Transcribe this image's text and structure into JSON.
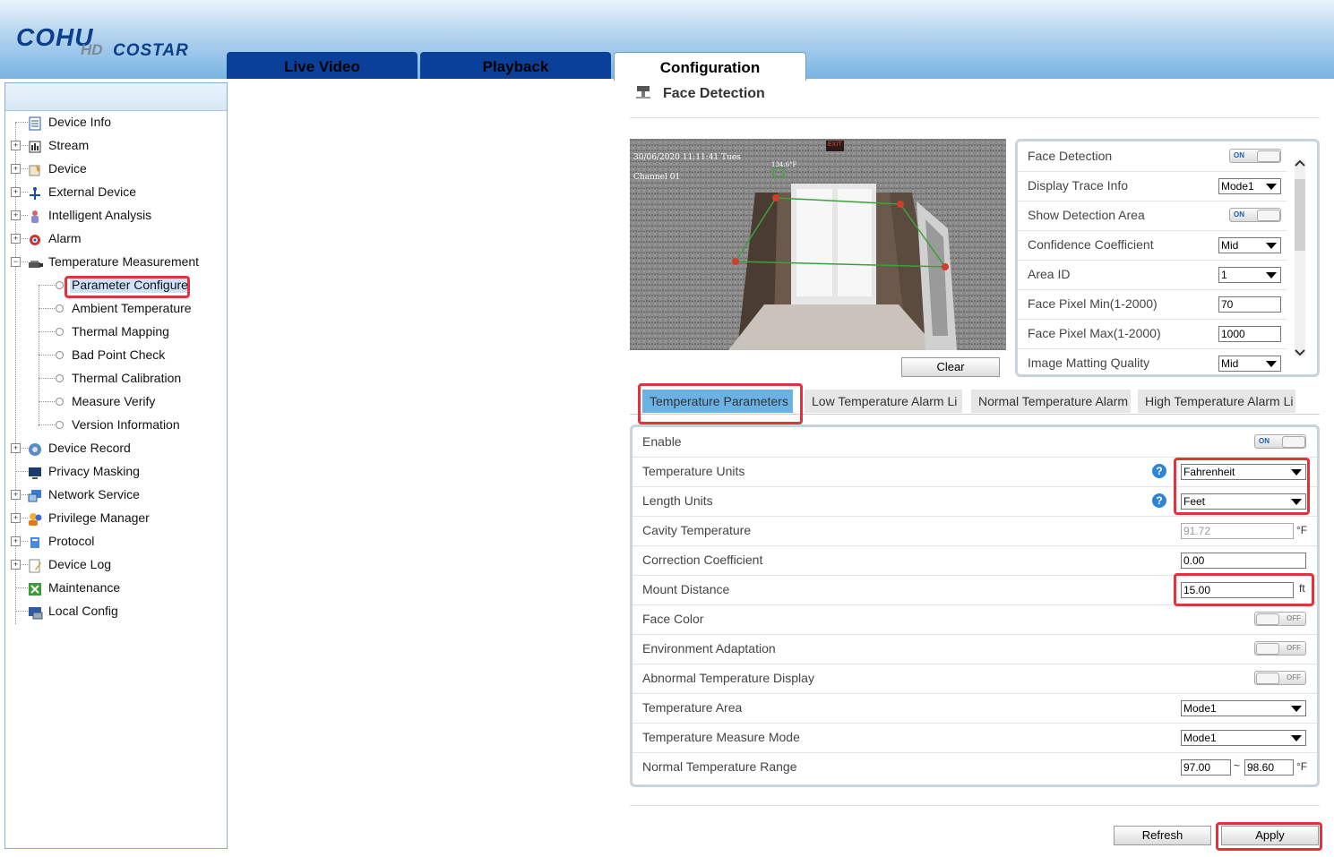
{
  "brand": {
    "line1": "COHU",
    "hd": "HD",
    "costar": "COSTAR"
  },
  "nav": [
    {
      "label": "Live Video"
    },
    {
      "label": "Playback"
    },
    {
      "label": "Configuration"
    }
  ],
  "sidebar": {
    "items": [
      {
        "label": "Device Info",
        "icon": "document-icon"
      },
      {
        "label": "Stream",
        "icon": "stream-icon"
      },
      {
        "label": "Device",
        "icon": "device-icon"
      },
      {
        "label": "External Device",
        "icon": "external-device-icon"
      },
      {
        "label": "Intelligent Analysis",
        "icon": "intelligent-analysis-icon"
      },
      {
        "label": "Alarm",
        "icon": "alarm-icon"
      },
      {
        "label": "Temperature Measurement",
        "icon": "camera-icon"
      },
      {
        "label": "Parameter Configure"
      },
      {
        "label": "Ambient Temperature"
      },
      {
        "label": "Thermal Mapping"
      },
      {
        "label": "Bad Point Check"
      },
      {
        "label": "Thermal Calibration"
      },
      {
        "label": "Measure Verify"
      },
      {
        "label": "Version Information"
      },
      {
        "label": "Device Record",
        "icon": "record-icon"
      },
      {
        "label": "Privacy Masking",
        "icon": "monitor-icon"
      },
      {
        "label": "Network Service",
        "icon": "network-icon"
      },
      {
        "label": "Privilege Manager",
        "icon": "users-icon"
      },
      {
        "label": "Protocol",
        "icon": "protocol-icon"
      },
      {
        "label": "Device Log",
        "icon": "log-icon"
      },
      {
        "label": "Maintenance",
        "icon": "maintenance-icon"
      },
      {
        "label": "Local Config",
        "icon": "local-config-icon"
      }
    ]
  },
  "page": {
    "title": "Face Detection"
  },
  "video": {
    "overlay_date": "30/06/2020 11:11:41 Tues",
    "overlay_channel": "Channel 01",
    "box_label": "134.6°F",
    "exit_sign": "EXIT"
  },
  "clear_label": "Clear",
  "face_settings": [
    {
      "label": "Face Detection",
      "type": "toggle",
      "value": "ON"
    },
    {
      "label": "Display Trace Info",
      "type": "select",
      "value": "Mode1"
    },
    {
      "label": "Show Detection Area",
      "type": "toggle",
      "value": "ON"
    },
    {
      "label": "Confidence Coefficient",
      "type": "select",
      "value": "Mid"
    },
    {
      "label": "Area ID",
      "type": "select",
      "value": "1"
    },
    {
      "label": "Face Pixel Min(1-2000)",
      "type": "input",
      "value": "70"
    },
    {
      "label": "Face Pixel Max(1-2000)",
      "type": "input",
      "value": "1000"
    },
    {
      "label": "Image Matting Quality",
      "type": "select",
      "value": "Mid"
    }
  ],
  "subtabs": [
    {
      "label": "Temperature Parameters"
    },
    {
      "label": "Low Temperature Alarm Li"
    },
    {
      "label": "Normal Temperature Alarm"
    },
    {
      "label": "High Temperature Alarm Li"
    }
  ],
  "temp_params": {
    "enable": {
      "label": "Enable",
      "value": "ON"
    },
    "temperature_units": {
      "label": "Temperature Units",
      "value": "Fahrenheit"
    },
    "length_units": {
      "label": "Length Units",
      "value": "Feet"
    },
    "cavity_temperature": {
      "label": "Cavity Temperature",
      "value": "91.72",
      "unit": "°F"
    },
    "correction_coefficient": {
      "label": "Correction Coefficient",
      "value": "0.00"
    },
    "mount_distance": {
      "label": "Mount Distance",
      "value": "15.00",
      "unit": "ft"
    },
    "face_color": {
      "label": "Face Color",
      "value": "OFF"
    },
    "environment_adaptation": {
      "label": "Environment Adaptation",
      "value": "OFF"
    },
    "abnormal_temperature_display": {
      "label": "Abnormal Temperature Display",
      "value": "OFF"
    },
    "temperature_area": {
      "label": "Temperature Area",
      "value": "Mode1"
    },
    "temperature_measure_mode": {
      "label": "Temperature Measure Mode",
      "value": "Mode1"
    },
    "normal_temperature_range": {
      "label": "Normal Temperature Range",
      "min": "97.00",
      "sep": "~",
      "max": "98.60",
      "unit": "°F"
    }
  },
  "help_glyph": "?",
  "buttons": {
    "refresh": "Refresh",
    "apply": "Apply"
  },
  "colors": {
    "nav_blue": "#0a3f9a",
    "highlight_red": "#e0333b",
    "active_subtab": "#6bb2e4",
    "help_blue": "#2d84d8"
  }
}
